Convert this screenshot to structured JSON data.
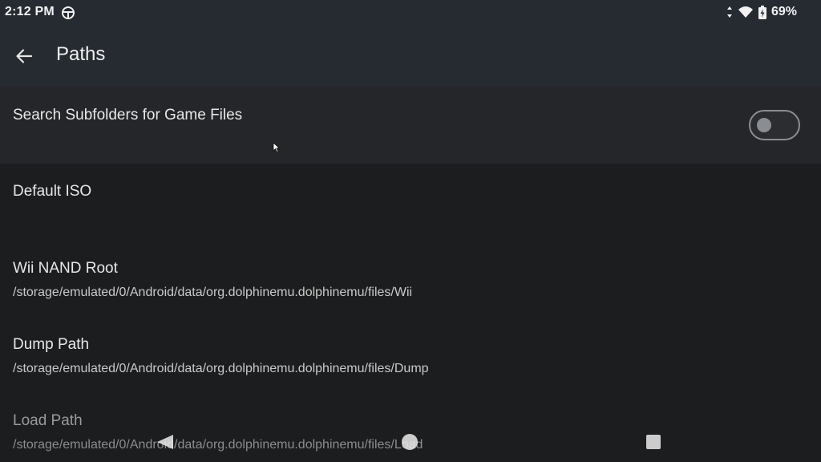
{
  "status_bar": {
    "time": "2:12 PM",
    "notification_icon": "steering-wheel-icon",
    "battery_percent": "69%",
    "icons": [
      "data-arrows-icon",
      "wifi-icon",
      "battery-charging-icon"
    ]
  },
  "toolbar": {
    "back_icon": "arrow-left-icon",
    "title": "Paths"
  },
  "settings": {
    "search_subfolders": {
      "title": "Search Subfolders for Game Files",
      "toggle_on": false
    },
    "default_iso": {
      "title": "Default ISO",
      "summary": ""
    },
    "wii_nand_root": {
      "title": "Wii NAND Root",
      "summary": "/storage/emulated/0/Android/data/org.dolphinemu.dolphinemu/files/Wii"
    },
    "dump_path": {
      "title": "Dump Path",
      "summary": "/storage/emulated/0/Android/data/org.dolphinemu.dolphinemu/files/Dump"
    },
    "load_path": {
      "title": "Load Path",
      "summary": "/storage/emulated/0/Android/data/org.dolphinemu.dolphinemu/files/Load"
    }
  },
  "nav_bar": {
    "icons": [
      "nav-back-icon",
      "nav-home-icon",
      "nav-recents-icon"
    ]
  },
  "colors": {
    "header": "#262b31",
    "background": "#1c1d1f",
    "highlight_row": "#242629",
    "toggle_off": "#8a8d92"
  }
}
